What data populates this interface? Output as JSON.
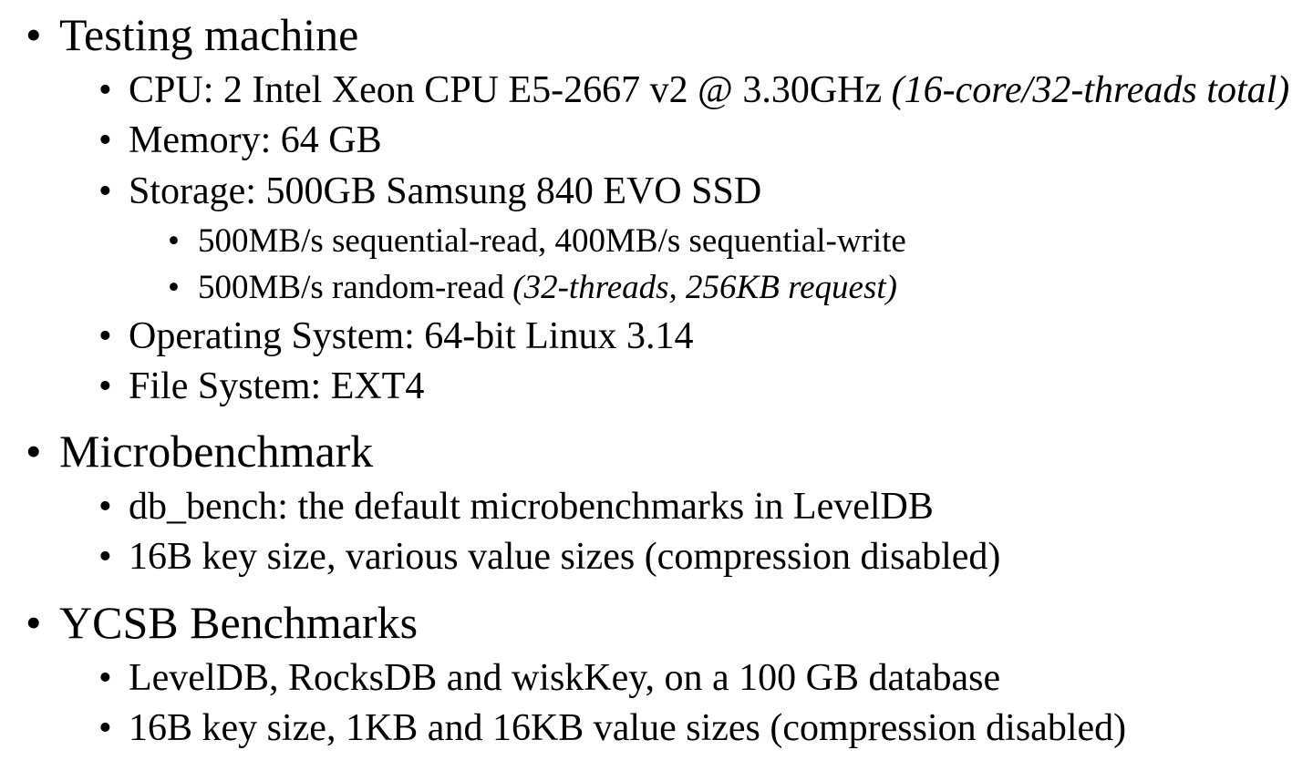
{
  "sections": [
    {
      "title": "Testing machine",
      "items": [
        {
          "text": "CPU: 2 Intel Xeon CPU E5-2667 v2 @ 3.30GHz ",
          "italic": "(16-core/32-threads total)"
        },
        {
          "text": "Memory: 64 GB"
        },
        {
          "text": "Storage: 500GB Samsung 840 EVO SSD",
          "subitems": [
            {
              "text": "500MB/s sequential-read, 400MB/s sequential-write"
            },
            {
              "text": "500MB/s random-read ",
              "italic": "(32-threads, 256KB request)"
            }
          ]
        },
        {
          "text": "Operating System: 64-bit Linux 3.14"
        },
        {
          "text": "File System: EXT4"
        }
      ]
    },
    {
      "title": "Microbenchmark",
      "items": [
        {
          "text": "db_bench: the default microbenchmarks in LevelDB"
        },
        {
          "text": "16B key size, various value sizes (compression disabled)"
        }
      ]
    },
    {
      "title": "YCSB Benchmarks",
      "items": [
        {
          "text": "LevelDB, RocksDB and wiskKey, on a 100 GB database"
        },
        {
          "text": "16B key size, 1KB and 16KB value sizes (compression disabled)"
        }
      ]
    }
  ],
  "bullet_glyph": "•"
}
